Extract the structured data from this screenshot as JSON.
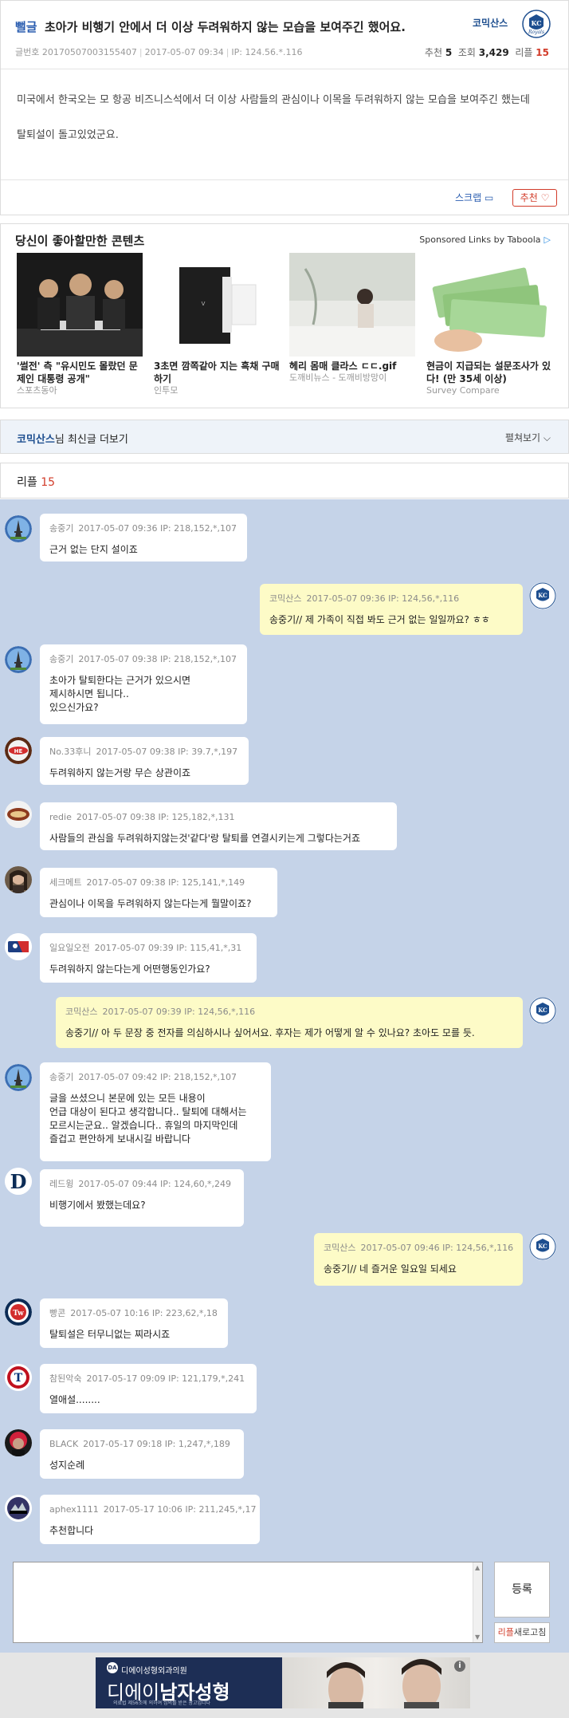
{
  "post": {
    "category": "뻘글",
    "title": "초아가 비행기 안에서 더 이상 두려워하지 않는 모습을 보여주긴 했어요.",
    "label_no": "글번호",
    "number": "20170507003155407",
    "datetime": "2017-05-07 09:34",
    "ip": "IP: 124.56.*.116",
    "author": "코믹산스",
    "stats": {
      "rec_label": "추천",
      "rec": "5",
      "view_label": "조회",
      "views": "3,429",
      "reply_label": "리플",
      "replies": "15"
    },
    "body": [
      "미국에서 한국오는 모 항공 비즈니스석에서 더 이상 사람들의 관심이나 이목을 두려워하지 않는 모습을 보여주긴 했는데",
      "탈퇴설이 돌고있었군요."
    ],
    "scrap_label": "스크랩",
    "recommend_label": "추천 ♡"
  },
  "sponsored": {
    "title": "당신이 좋아할만한 콘텐츠",
    "label": "Sponsored Links by Taboola",
    "items": [
      {
        "caption": "'썰전' 측 \"유시민도 몰랐던 문제인 대통령 공개\"",
        "source": "스포츠동아"
      },
      {
        "caption": "3초면 깜쪽같아 지는 흑채 구매하기",
        "source": "인투모"
      },
      {
        "caption": "헤리 몸매 클라스 ㄷㄷ.gif",
        "source": "도깨비뉴스 - 도깨비방망이"
      },
      {
        "caption": "현금이 지급되는 설문조사가 있다! (만 35세 이상)",
        "source": "Survey Compare"
      }
    ]
  },
  "more": {
    "author": "코믹산스",
    "suffix": "님 최신글 더보기",
    "toggle": "펼쳐보기 ⌵"
  },
  "replies_header": {
    "label": "리플",
    "count": "15"
  },
  "comments": [
    {
      "nick": "송중기",
      "meta": "2017-05-07 09:36  IP: 218,152,*,107",
      "text": "근거 없는 단지 설이죠"
    },
    {
      "nick": "코믹산스",
      "meta": "2017-05-07 09:36  IP: 124,56,*,116",
      "text": "송중기// 제 가족이 직접 봐도 근거 없는 일일까요? ㅎㅎ"
    },
    {
      "nick": "송중기",
      "meta": "2017-05-07 09:38  IP: 218,152,*,107",
      "text": "초아가 탈퇴한다는 근거가 있으시면\n제시하시면 됩니다..\n있으신가요?"
    },
    {
      "nick": "No.33후니",
      "meta": "2017-05-07 09:38  IP: 39.7,*,197",
      "text": "두려워하지 않는거랑 무슨 상관이죠"
    },
    {
      "nick": "redie",
      "meta": "2017-05-07 09:38  IP: 125,182,*,131",
      "text": "사람들의 관심을 두려워하지않는것'같다'랑 탈퇴를 연결시키는게 그렇다는거죠"
    },
    {
      "nick": "세크메트",
      "meta": "2017-05-07 09:38  IP: 125,141,*,149",
      "text": "관심이나 이목을 두려워하지 않는다는게 뭘말이죠?"
    },
    {
      "nick": "일요일오전",
      "meta": "2017-05-07 09:39  IP: 115,41,*,31",
      "text": "두려워하지 않는다는게 어떤행동인가요?"
    },
    {
      "nick": "코믹산스",
      "meta": "2017-05-07 09:39  IP: 124,56,*,116",
      "text": "송중기// 아 두 문장 중 전자를 의심하시나 싶어서요. 후자는 제가 어떻게 알 수 있나요? 초아도 모를 듯."
    },
    {
      "nick": "송중기",
      "meta": "2017-05-07 09:42  IP: 218,152,*,107",
      "text": "글을 쓰셨으니 본문에 있는 모든 내용이\n언급 대상이 된다고 생각합니다.. 탈퇴에 대해서는\n모르시는군요.. 알겠습니다.. 휴일의 마지막인데\n즐겁고 편안하게 보내시길 바랍니다"
    },
    {
      "nick": "레드윙",
      "meta": "2017-05-07 09:44  IP: 124,60,*,249",
      "text": "비행기에서 봤했는데요?"
    },
    {
      "nick": "코믹산스",
      "meta": "2017-05-07 09:46  IP: 124,56,*,116",
      "text": "송중기// 네 즐거운 일요일 되세요"
    },
    {
      "nick": "빵콘",
      "meta": "2017-05-07 10:16  IP: 223,62,*,18",
      "text": "탈퇴설은 터무니없는 찌라시죠"
    },
    {
      "nick": "참된악숙",
      "meta": "2017-05-17 09:09  IP: 121,179,*,241",
      "text": "열애설........"
    },
    {
      "nick": "BLACK",
      "meta": "2017-05-17 09:18  IP: 1,247,*,189",
      "text": "성지순례"
    },
    {
      "nick": "aphex1111",
      "meta": "2017-05-17 10:06  IP: 211,245,*,17",
      "text": "추천합니다"
    }
  ],
  "form": {
    "submit_label": "등록",
    "refresh_red": "리플",
    "refresh_label": "새로고침"
  },
  "banner": {
    "small": "디에이성형외과의원",
    "big_prefix": "디에이",
    "big_main": "남자성형",
    "fine": "의료법 제56조에 의하여 심의를 받은 광고입니다",
    "info": "i"
  }
}
